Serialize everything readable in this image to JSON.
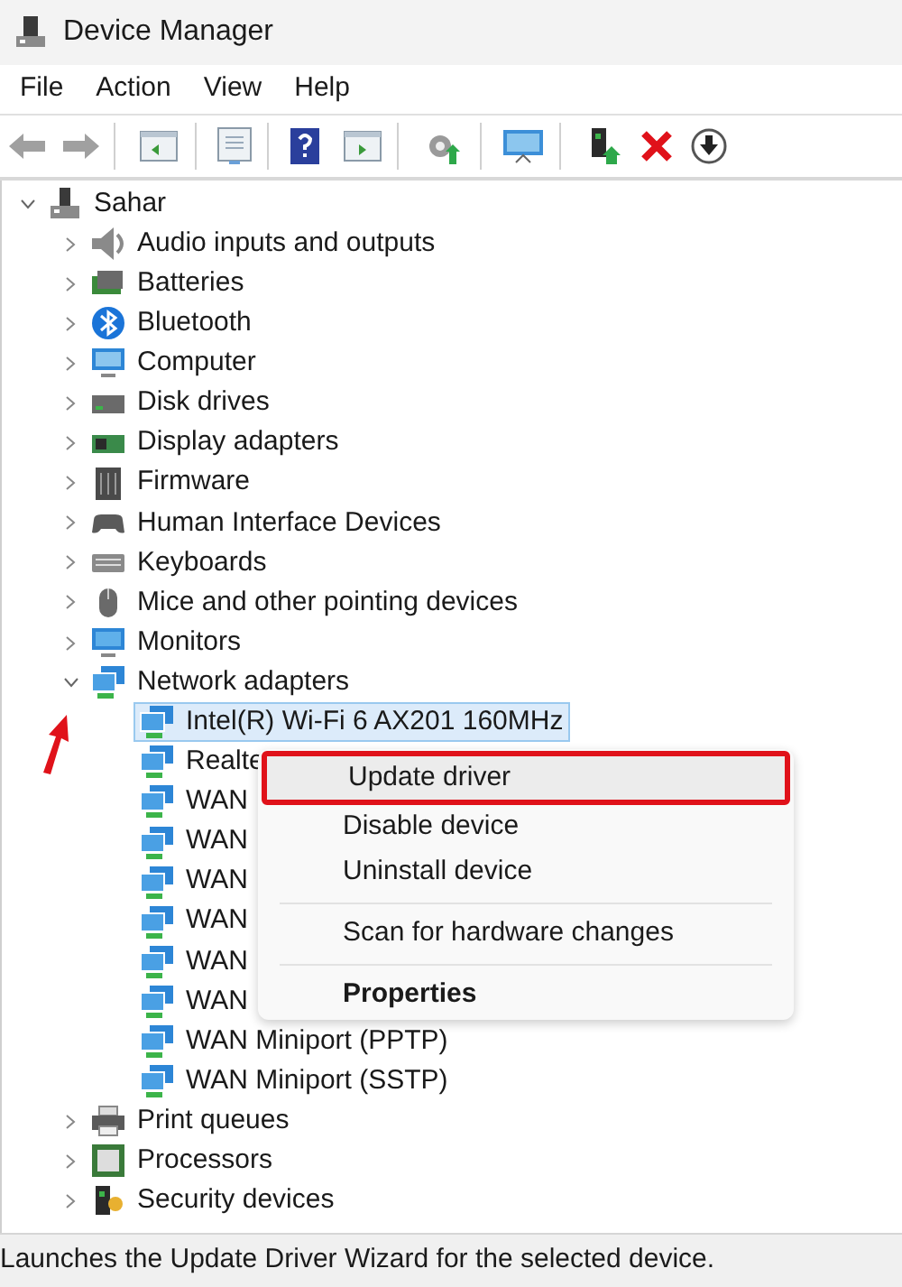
{
  "window": {
    "title": "Device Manager"
  },
  "menu_bar": [
    "File",
    "Action",
    "View",
    "Help"
  ],
  "tree": {
    "label": "Sahar",
    "expanded": true,
    "selected": false,
    "children": [
      {
        "label": "Audio inputs and outputs",
        "expanded": false,
        "selected": false
      },
      {
        "label": "Batteries",
        "expanded": false,
        "selected": false
      },
      {
        "label": "Bluetooth",
        "expanded": false,
        "selected": false
      },
      {
        "label": "Computer",
        "expanded": false,
        "selected": false
      },
      {
        "label": "Disk drives",
        "expanded": false,
        "selected": false
      },
      {
        "label": "Display adapters",
        "expanded": false,
        "selected": false
      },
      {
        "label": "Firmware",
        "expanded": false,
        "selected": false
      },
      {
        "label": "Human Interface Devices",
        "expanded": false,
        "selected": false
      },
      {
        "label": "Keyboards",
        "expanded": false,
        "selected": false
      },
      {
        "label": "Mice and other pointing devices",
        "expanded": false,
        "selected": false
      },
      {
        "label": "Monitors",
        "expanded": false,
        "selected": false
      },
      {
        "label": "Network adapters",
        "expanded": true,
        "selected": false,
        "children": [
          {
            "label": "Intel(R) Wi-Fi 6 AX201 160MHz",
            "selected": true
          },
          {
            "label": "Realte",
            "selected": false
          },
          {
            "label": "WAN",
            "selected": false
          },
          {
            "label": "WAN",
            "selected": false
          },
          {
            "label": "WAN",
            "selected": false
          },
          {
            "label": "WAN",
            "selected": false
          },
          {
            "label": "WAN",
            "selected": false
          },
          {
            "label": "WAN",
            "selected": false
          },
          {
            "label": "WAN Miniport (PPTP)",
            "selected": false
          },
          {
            "label": "WAN Miniport (SSTP)",
            "selected": false
          }
        ]
      },
      {
        "label": "Print queues",
        "expanded": false,
        "selected": false
      },
      {
        "label": "Processors",
        "expanded": false,
        "selected": false
      },
      {
        "label": "Security devices",
        "expanded": false,
        "selected": false
      }
    ]
  },
  "context_menu": [
    {
      "kind": "item",
      "label": "Update driver",
      "highlighted": true
    },
    {
      "kind": "item",
      "label": "Disable device",
      "highlighted": false
    },
    {
      "kind": "item",
      "label": "Uninstall device",
      "highlighted": false
    },
    {
      "kind": "separator"
    },
    {
      "kind": "item",
      "label": "Scan for hardware changes",
      "highlighted": false
    },
    {
      "kind": "separator"
    },
    {
      "kind": "default",
      "label": "Properties",
      "highlighted": false
    }
  ],
  "status_bar": "Launches the Update Driver Wizard for the selected device."
}
